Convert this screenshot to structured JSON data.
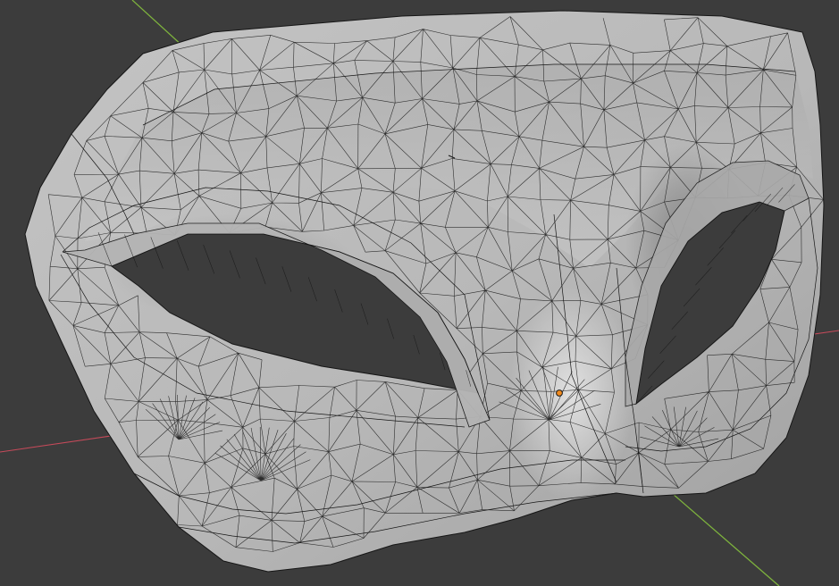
{
  "app": "3D viewport",
  "view": {
    "background_color": "#3c3c3c",
    "grid_color": "#404040",
    "axis_x_color": "#c64a5a",
    "axis_y_color": "#7eb33d",
    "axis_z_color": "#2e6fbf",
    "origin_color": "#f08a1e"
  },
  "scene_object": {
    "name_semantic": "mask-mesh",
    "display_mode": "solid-wireframe",
    "surface_color": "#b9b9b9",
    "edge_color": "#161616"
  }
}
